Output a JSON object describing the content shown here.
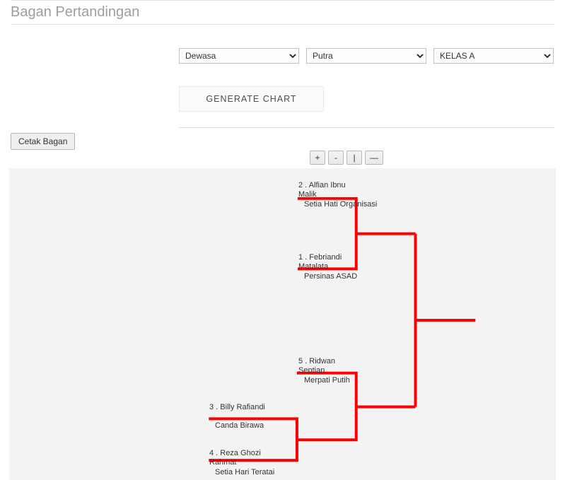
{
  "title": "Bagan Pertandingan",
  "filters": {
    "age_group": "Dewasa",
    "gender": "Putra",
    "class": "KELAS A"
  },
  "buttons": {
    "generate": "GENERATE CHART",
    "print": "Cetak Bagan",
    "zoom_in": "+",
    "zoom_out": "-",
    "zoom_reset": "|",
    "zoom_fit": "—"
  },
  "bracket": {
    "p1": {
      "seed": "2",
      "name": "Alfian Ibnu",
      "name2": "Malik",
      "org": "Setia Hati Organisasi"
    },
    "p2": {
      "seed": "1",
      "name": "Febriandi",
      "name2": "Matalata",
      "org": "Persinas ASAD"
    },
    "p3": {
      "seed": "5",
      "name": "Ridwan",
      "name2": "Septian",
      "org": "Merpati Putih"
    },
    "p4": {
      "seed": "3",
      "name": "Billy Rafiandi",
      "org": "Canda Birawa"
    },
    "p5": {
      "seed": "4",
      "name": "Reza Ghozi",
      "name2": "Rahmat",
      "org": "Setia Hari Teratai"
    }
  },
  "bracket_colors": {
    "line": "#ff0000"
  }
}
